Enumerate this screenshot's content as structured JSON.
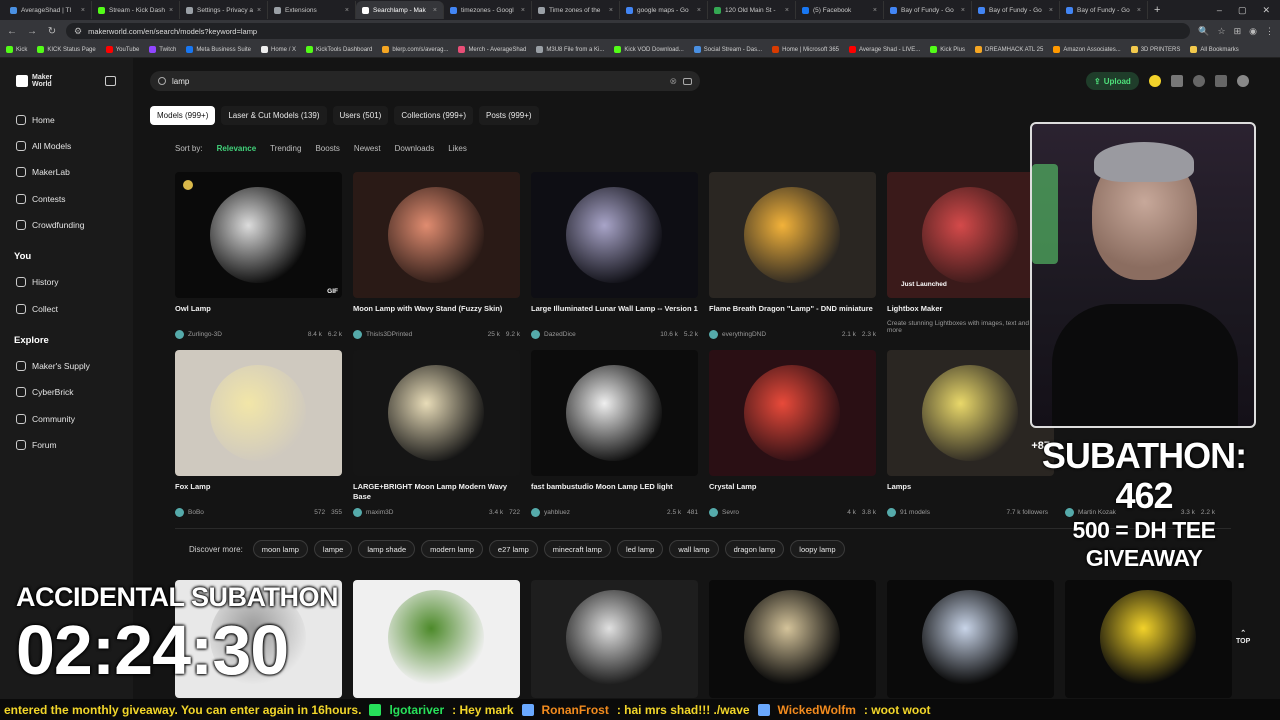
{
  "browser": {
    "tabs": [
      {
        "title": "AverageShad | TI",
        "color": "#4a90e2"
      },
      {
        "title": "Stream - Kick Dash",
        "color": "#53fc18"
      },
      {
        "title": "Settings - Privacy a",
        "color": "#9aa0a6"
      },
      {
        "title": "Extensions",
        "color": "#9aa0a6"
      },
      {
        "title": "Searchlamp - Mak",
        "color": "#ffffff",
        "active": true
      },
      {
        "title": "timezones - Googl",
        "color": "#4285f4"
      },
      {
        "title": "Time zones of the",
        "color": "#9aa0a6"
      },
      {
        "title": "google maps - Go",
        "color": "#4285f4"
      },
      {
        "title": "120 Old Main St -",
        "color": "#34a853"
      },
      {
        "title": "(5) Facebook",
        "color": "#1877f2"
      },
      {
        "title": "Bay of Fundy - Go",
        "color": "#4285f4"
      },
      {
        "title": "Bay of Fundy - Go",
        "color": "#4285f4"
      },
      {
        "title": "Bay of Fundy - Go",
        "color": "#4285f4"
      }
    ],
    "new_tab": "+",
    "url": "makerworld.com/en/search/models?keyword=lamp",
    "bookmarks": [
      {
        "label": "Kick",
        "color": "#53fc18"
      },
      {
        "label": "KICK Status Page",
        "color": "#53fc18"
      },
      {
        "label": "YouTube",
        "color": "#ff0000"
      },
      {
        "label": "Twitch",
        "color": "#9146ff"
      },
      {
        "label": "Meta Business Suite",
        "color": "#1877f2"
      },
      {
        "label": "Home / X",
        "color": "#eeeeee"
      },
      {
        "label": "KickTools Dashboard",
        "color": "#53fc18"
      },
      {
        "label": "blerp.com/s/averag...",
        "color": "#f5a623"
      },
      {
        "label": "Merch - AverageShad",
        "color": "#e94e77"
      },
      {
        "label": "M3U8 File from a Ki...",
        "color": "#9aa0a6"
      },
      {
        "label": "Kick VOD Download...",
        "color": "#53fc18"
      },
      {
        "label": "Social Stream - Das...",
        "color": "#4a90e2"
      },
      {
        "label": "Home | Microsoft 365",
        "color": "#d83b01"
      },
      {
        "label": "Average Shad - LIVE...",
        "color": "#ff0000"
      },
      {
        "label": "Kick Plus",
        "color": "#53fc18"
      },
      {
        "label": "DREAMHACK ATL 25",
        "color": "#f5a623"
      },
      {
        "label": "Amazon Associates...",
        "color": "#ff9900"
      },
      {
        "label": "3D PRINTERS",
        "color": "#f2c94c"
      },
      {
        "label": "All Bookmarks",
        "color": "#f2c94c"
      }
    ]
  },
  "sidebar": {
    "logo_line1": "Maker",
    "logo_line2": "World",
    "items": [
      {
        "label": "Home"
      },
      {
        "label": "All Models"
      },
      {
        "label": "MakerLab"
      },
      {
        "label": "Contests"
      },
      {
        "label": "Crowdfunding"
      }
    ],
    "you_header": "You",
    "you_items": [
      {
        "label": "History"
      },
      {
        "label": "Collect"
      }
    ],
    "explore_header": "Explore",
    "explore_items": [
      {
        "label": "Maker's Supply"
      },
      {
        "label": "CyberBrick"
      },
      {
        "label": "Community"
      },
      {
        "label": "Forum"
      }
    ]
  },
  "search": {
    "value": "lamp"
  },
  "header": {
    "upload_label": "Upload"
  },
  "categories": [
    {
      "label": "Models (999+)",
      "active": true
    },
    {
      "label": "Laser & Cut Models (139)"
    },
    {
      "label": "Users (501)"
    },
    {
      "label": "Collections (999+)"
    },
    {
      "label": "Posts (999+)"
    }
  ],
  "sort": {
    "label": "Sort by:",
    "options": [
      "Relevance",
      "Trending",
      "Boosts",
      "Newest",
      "Downloads",
      "Likes"
    ],
    "active": "Relevance"
  },
  "cards": [
    {
      "title": "Owl Lamp",
      "author": "Zurlingo-3D",
      "downloads": "8.4 k",
      "likes": "6.2 k",
      "badge": "GIF",
      "bg": "#0a0a0a",
      "accent": "#dcdcdc"
    },
    {
      "title": "Moon Lamp with Wavy Stand (Fuzzy Skin)",
      "author": "ThisIs3DPrinted",
      "downloads": "25 k",
      "likes": "9.2 k",
      "bg": "#2a1a16",
      "accent": "#e08c70"
    },
    {
      "title": "Large Illuminated Lunar Wall Lamp -- Version 1",
      "author": "DazedDice",
      "downloads": "10.6 k",
      "likes": "5.2 k",
      "bg": "#0e0e14",
      "accent": "#a8a4c8"
    },
    {
      "title": "Flame Breath Dragon \"Lamp\" - DND miniature",
      "author": "everythingDND",
      "downloads": "2.1 k",
      "likes": "2.3 k",
      "bg": "#2a2622",
      "accent": "#f2b23a"
    },
    {
      "title": "Lightbox Maker",
      "author": "Create stunning Lightboxes with images, text and more",
      "downloads": "",
      "likes": "",
      "badge": "Just Launched",
      "bg": "#3a1a1a",
      "accent": "#d44a4a"
    },
    {
      "title": "Fox Lamp",
      "author": "BoBo",
      "downloads": "572",
      "likes": "355",
      "bg": "#cfc9bf",
      "accent": "#f2e6a8"
    },
    {
      "title": "LARGE+BRIGHT Moon Lamp Modern Wavy Base",
      "author": "maxim3D",
      "downloads": "3.4 k",
      "likes": "722",
      "bg": "#151515",
      "accent": "#e8dcb8"
    },
    {
      "title": "fast bambustudio Moon Lamp LED light",
      "author": "yahbluez",
      "downloads": "2.5 k",
      "likes": "481",
      "bg": "#0c0c0c",
      "accent": "#efefef"
    },
    {
      "title": "Crystal Lamp",
      "author": "Sevro",
      "downloads": "4 k",
      "likes": "3.8 k",
      "bg": "#2a0f14",
      "accent": "#e84a3a"
    },
    {
      "title": "Lamps",
      "author": "91 models",
      "downloads": "7.7 k followers",
      "likes": "",
      "badge": "+87",
      "bg": "#2a2622",
      "accent": "#e9d86a"
    },
    {
      "title": "",
      "author": "Martin Kozak",
      "downloads": "3.3 k",
      "likes": "2.2 k",
      "bg": "#141414",
      "accent": "#141414"
    }
  ],
  "discover": {
    "label": "Discover more:",
    "chips": [
      "moon lamp",
      "lampe",
      "lamp shade",
      "modern lamp",
      "e27 lamp",
      "minecraft lamp",
      "led lamp",
      "wall lamp",
      "dragon lamp",
      "loopy lamp"
    ]
  },
  "bottom_cards": [
    {
      "bg": "#e8e8e8"
    },
    {
      "bg": "#f0f0f0"
    },
    {
      "bg": "#1e1e1e"
    },
    {
      "bg": "#0a0a0a"
    },
    {
      "bg": "#0a0a0a"
    },
    {
      "bg": "#0a0a0a"
    }
  ],
  "overlay": {
    "subathon_line1": "SUBATHON: 462",
    "subathon_line2": "500 = DH TEE GIVEAWAY",
    "accidental": "ACCIDENTAL SUBATHON",
    "timer": "02:24:30",
    "to_top": "TOP"
  },
  "ticker": [
    {
      "text": "entered the monthly giveaway. You can enter again in 16hours.",
      "cls": "y"
    },
    {
      "text": "lgotariver",
      "cls": "g"
    },
    {
      "text": ": Hey mark",
      "cls": "y"
    },
    {
      "text": "RonanFrost",
      "cls": "o"
    },
    {
      "text": ": hai mrs shad!!! ./wave",
      "cls": "y"
    },
    {
      "text": "WickedWolfm",
      "cls": "o"
    },
    {
      "text": ": woot woot",
      "cls": "y"
    }
  ]
}
